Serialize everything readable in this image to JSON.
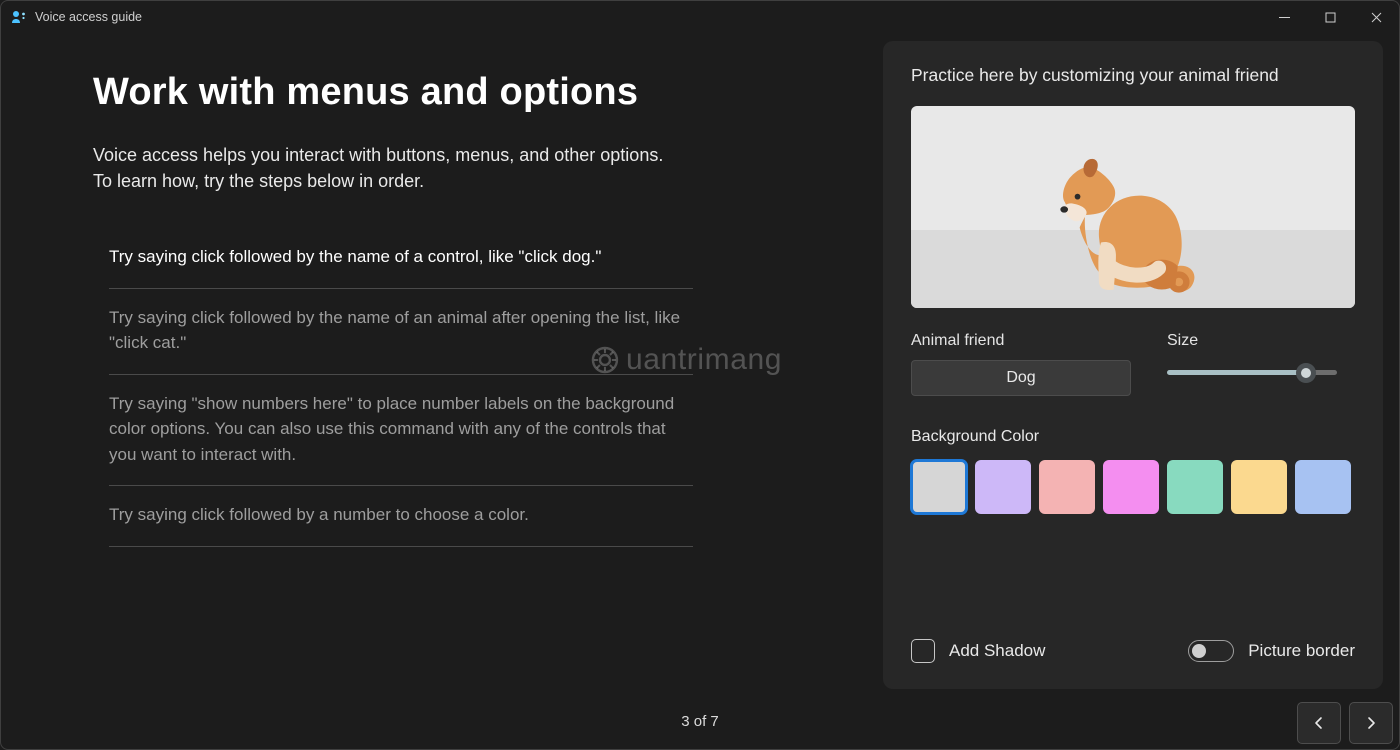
{
  "window": {
    "title": "Voice access guide"
  },
  "page": {
    "heading": "Work with menus and options",
    "intro": "Voice access helps you interact with buttons, menus, and other options. To learn how, try the steps below in order.",
    "steps": [
      "Try saying click followed by the name of a control, like \"click dog.\"",
      "Try saying click followed by the name of an animal after opening the list, like \"click cat.\"",
      "Try saying \"show numbers here\" to place number labels on the background color options. You can also use this command with any of the controls that you want to interact with.",
      "Try saying click followed by a number to choose a color."
    ],
    "active_step": 0
  },
  "practice": {
    "title": "Practice here by customizing your animal friend",
    "animal_label": "Animal friend",
    "animal_value": "Dog",
    "size_label": "Size",
    "size_value": 82,
    "bg_label": "Background Color",
    "swatches": [
      "#d6d6d6",
      "#cdb8f8",
      "#f4b3b3",
      "#f48ef0",
      "#88dabf",
      "#fbd98f",
      "#a7c2f2"
    ],
    "selected_swatch": 0,
    "add_shadow_label": "Add Shadow",
    "add_shadow_checked": false,
    "picture_border_label": "Picture border",
    "picture_border_on": false,
    "canvas_bg": "#e8e8e8",
    "canvas_ground": "#dadada"
  },
  "footer": {
    "page_indicator": "3 of 7"
  },
  "watermark": "uantrimang"
}
